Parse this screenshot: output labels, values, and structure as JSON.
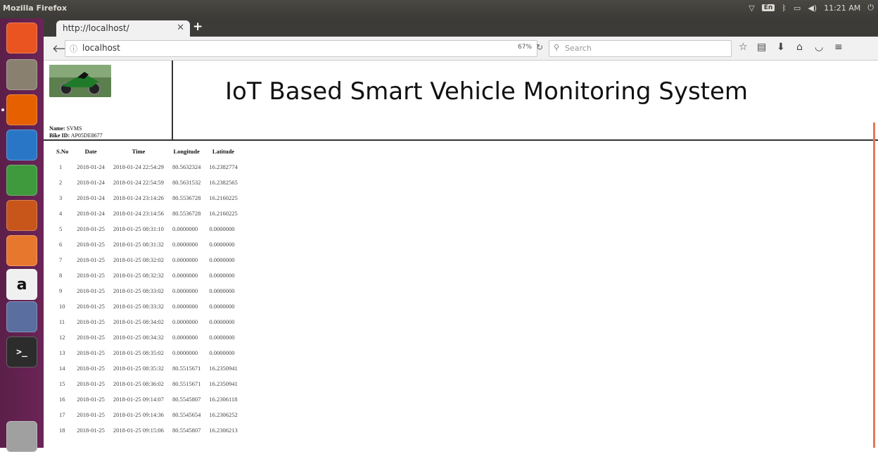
{
  "system_panel": {
    "app_title": "Mozilla Firefox",
    "keyboard": "En",
    "time": "11:21 AM"
  },
  "launcher": {
    "items": [
      {
        "icon": "ubuntu-dash-icon",
        "color": "#e95420"
      },
      {
        "icon": "files-icon",
        "color": "#8a8070"
      },
      {
        "icon": "firefox-icon",
        "color": "#e66000"
      },
      {
        "icon": "writer-icon",
        "color": "#2a76c6"
      },
      {
        "icon": "calc-icon",
        "color": "#3e9a3c"
      },
      {
        "icon": "impress-icon",
        "color": "#c8551a"
      },
      {
        "icon": "software-center-icon",
        "color": "#e8772e"
      },
      {
        "icon": "amazon-icon",
        "color": "#f0f0f0",
        "glyph": "a"
      },
      {
        "icon": "settings-icon",
        "color": "#5a6ea0"
      },
      {
        "icon": "terminal-icon",
        "color": "#2c2c2c",
        "glyph": ">_"
      },
      {
        "icon": "trash-icon",
        "color": "#a0a0a0"
      }
    ]
  },
  "browser": {
    "tab_title": "http://localhost/",
    "url": "localhost",
    "zoom": "67%",
    "search_placeholder": "Search"
  },
  "page": {
    "title": "IoT Based Smart Vehicle Monitoring System",
    "name_label": "Name:",
    "name_value": "SVMS",
    "bike_id_label": "Bike ID:",
    "bike_id_value": "AP05DE8677"
  },
  "table": {
    "headers": [
      "S.No",
      "Date",
      "Time",
      "Longitude",
      "Latitude"
    ],
    "rows": [
      [
        "1",
        "2018-01-24",
        "2018-01-24 22:54:29",
        "80.5632324",
        "16.2382774"
      ],
      [
        "2",
        "2018-01-24",
        "2018-01-24 22:54:59",
        "80.5631532",
        "16.2382565"
      ],
      [
        "3",
        "2018-01-24",
        "2018-01-24 23:14:26",
        "80.5536728",
        "16.2160225"
      ],
      [
        "4",
        "2018-01-24",
        "2018-01-24 23:14:56",
        "80.5536728",
        "16.2160225"
      ],
      [
        "5",
        "2018-01-25",
        "2018-01-25 08:31:10",
        "0.0000000",
        "0.0000000"
      ],
      [
        "6",
        "2018-01-25",
        "2018-01-25 08:31:32",
        "0.0000000",
        "0.0000000"
      ],
      [
        "7",
        "2018-01-25",
        "2018-01-25 08:32:02",
        "0.0000000",
        "0.0000000"
      ],
      [
        "8",
        "2018-01-25",
        "2018-01-25 08:32:32",
        "0.0000000",
        "0.0000000"
      ],
      [
        "9",
        "2018-01-25",
        "2018-01-25 08:33:02",
        "0.0000000",
        "0.0000000"
      ],
      [
        "10",
        "2018-01-25",
        "2018-01-25 08:33:32",
        "0.0000000",
        "0.0000000"
      ],
      [
        "11",
        "2018-01-25",
        "2018-01-25 08:34:02",
        "0.0000000",
        "0.0000000"
      ],
      [
        "12",
        "2018-01-25",
        "2018-01-25 08:34:32",
        "0.0000000",
        "0.0000000"
      ],
      [
        "13",
        "2018-01-25",
        "2018-01-25 08:35:02",
        "0.0000000",
        "0.0000000"
      ],
      [
        "14",
        "2018-01-25",
        "2018-01-25 08:35:32",
        "80.5515671",
        "16.2350941"
      ],
      [
        "15",
        "2018-01-25",
        "2018-01-25 08:36:02",
        "80.5515671",
        "16.2350941"
      ],
      [
        "16",
        "2018-01-25",
        "2018-01-25 09:14:07",
        "80.5545807",
        "16.2306118"
      ],
      [
        "17",
        "2018-01-25",
        "2018-01-25 09:14:36",
        "80.5545654",
        "16.2306252"
      ],
      [
        "18",
        "2018-01-25",
        "2018-01-25 09:15:06",
        "80.5545807",
        "16.2306213"
      ]
    ]
  }
}
